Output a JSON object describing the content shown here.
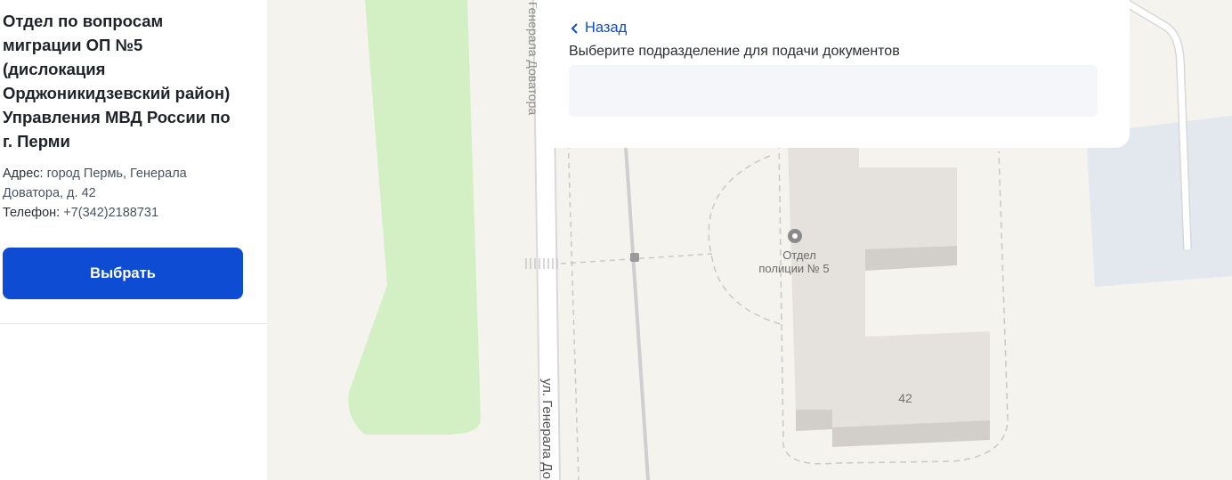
{
  "office": {
    "title": "Отдел по вопросам\nмиграции ОП №5\n(дислокация\nОрджоникидзевский район)\nУправления МВД России по\nг. Перми",
    "address_key": "Адрес:",
    "address_value": "город Пермь, Генерала Доватора, д. 42",
    "phone_key": "Телефон:",
    "phone_value": "+7(342)2188731",
    "select_label": "Выбрать"
  },
  "panel": {
    "back_label": "Назад",
    "field_label": "Выберите подразделение для подачи документов",
    "field_value": ""
  },
  "map": {
    "street_top": "Генерала Доватора",
    "street_bottom": "ул. Генерала До",
    "poi_line1": "Отдел",
    "poi_line2": "полиции № 5",
    "house_number": "42",
    "colors": {
      "background": "#f4f3ee",
      "park": "#d3f0c4",
      "building": "#e5e2de",
      "water": "#e2e8ee",
      "accent": "#0d4cd3"
    }
  }
}
